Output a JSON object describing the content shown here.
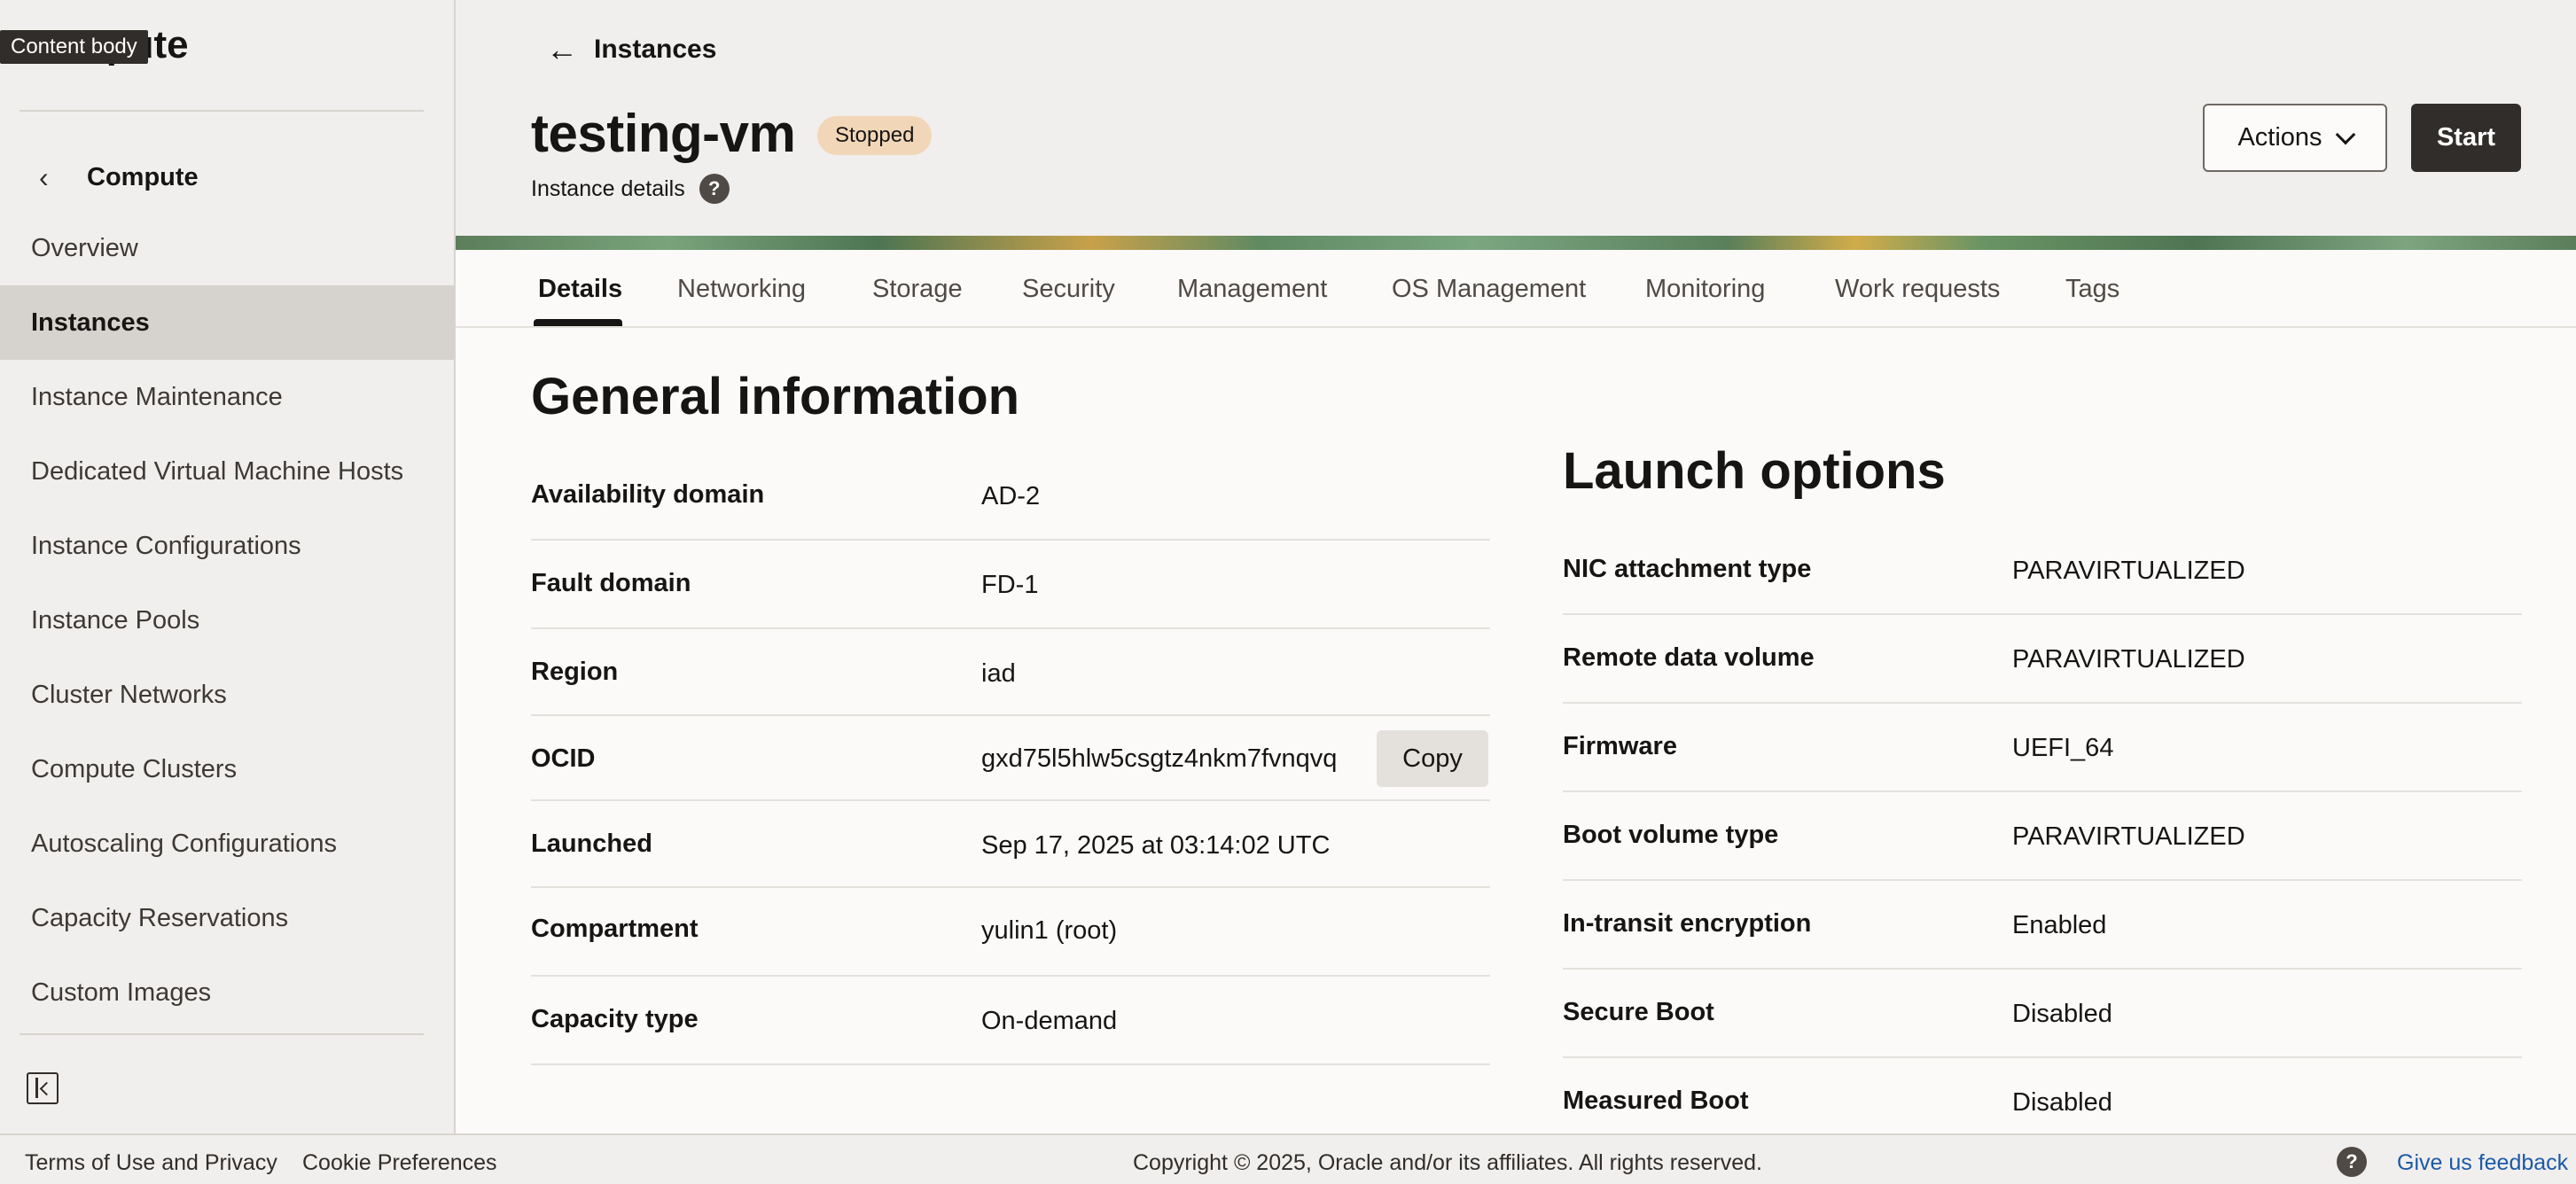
{
  "sidebar": {
    "title": "Compute",
    "tooltip": "Content body",
    "back_label": "Compute",
    "items": [
      {
        "label": "Overview",
        "active": false
      },
      {
        "label": "Instances",
        "active": true
      },
      {
        "label": "Instance Maintenance",
        "active": false
      },
      {
        "label": "Dedicated Virtual Machine Hosts",
        "active": false
      },
      {
        "label": "Instance Configurations",
        "active": false
      },
      {
        "label": "Instance Pools",
        "active": false
      },
      {
        "label": "Cluster Networks",
        "active": false
      },
      {
        "label": "Compute Clusters",
        "active": false
      },
      {
        "label": "Autoscaling Configurations",
        "active": false
      },
      {
        "label": "Capacity Reservations",
        "active": false
      },
      {
        "label": "Custom Images",
        "active": false
      }
    ]
  },
  "header": {
    "back_label": "Instances",
    "title": "testing-vm",
    "status": "Stopped",
    "subtitle": "Instance details",
    "actions_label": "Actions",
    "start_label": "Start"
  },
  "tabs": [
    "Details",
    "Networking",
    "Storage",
    "Security",
    "Management",
    "OS Management",
    "Monitoring",
    "Work requests",
    "Tags"
  ],
  "general": {
    "title": "General information",
    "rows": [
      {
        "label": "Availability domain",
        "value": "AD-2"
      },
      {
        "label": "Fault domain",
        "value": "FD-1"
      },
      {
        "label": "Region",
        "value": "iad"
      },
      {
        "label": "OCID",
        "value": "gxd75l5hlw5csgtz4nkm7fvnqvq",
        "copy": "Copy"
      },
      {
        "label": "Launched",
        "value": "Sep 17, 2025 at 03:14:02 UTC"
      },
      {
        "label": "Compartment",
        "value": "yulin1 (root)"
      },
      {
        "label": "Capacity type",
        "value": "On-demand"
      }
    ]
  },
  "launch": {
    "title": "Launch options",
    "rows": [
      {
        "label": "NIC attachment type",
        "value": "PARAVIRTUALIZED"
      },
      {
        "label": "Remote data volume",
        "value": "PARAVIRTUALIZED"
      },
      {
        "label": "Firmware",
        "value": "UEFI_64"
      },
      {
        "label": "Boot volume type",
        "value": "PARAVIRTUALIZED"
      },
      {
        "label": "In-transit encryption",
        "value": "Enabled"
      },
      {
        "label": "Secure Boot",
        "value": "Disabled"
      },
      {
        "label": "Measured Boot",
        "value": "Disabled"
      }
    ]
  },
  "footer": {
    "terms": "Terms of Use and Privacy",
    "cookies": "Cookie Preferences",
    "copyright": "Copyright © 2025, Oracle and/or its affiliates. All rights reserved.",
    "feedback": "Give us feedback"
  },
  "icons": {
    "back": "arrow-left-icon",
    "help": "question-circle-icon",
    "chevron": "chevron-down-icon",
    "collapse": "collapse-sidebar-icon"
  }
}
